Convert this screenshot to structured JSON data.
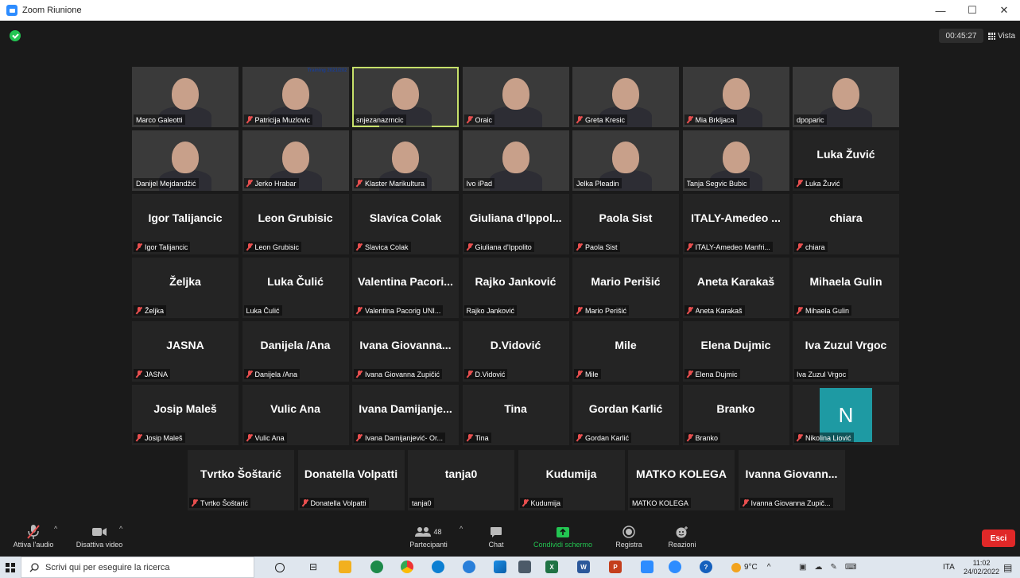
{
  "window": {
    "title": "Zoom Riunione",
    "minimize": "—",
    "maximize": "☐",
    "close": "✕"
  },
  "header": {
    "timer": "00:45:27",
    "view_label": "Vista"
  },
  "tiles": [
    {
      "id": "t1",
      "big": "",
      "label": "Marco Galeotti",
      "muted": false,
      "video": true,
      "bg": "bg1"
    },
    {
      "id": "t2",
      "big": "",
      "label": "Patricija Muzlovic",
      "muted": true,
      "video": true,
      "bg": "bg2",
      "overlay": "Training 2021/202"
    },
    {
      "id": "t3",
      "big": "",
      "label": "snjezanazrncic",
      "muted": false,
      "video": true,
      "bg": "bg3",
      "active": true
    },
    {
      "id": "t4",
      "big": "",
      "label": "Oraic",
      "muted": true,
      "video": true,
      "bg": "bg4"
    },
    {
      "id": "t5",
      "big": "",
      "label": "Greta Kresic",
      "muted": true,
      "video": true,
      "bg": "bg5"
    },
    {
      "id": "t6",
      "big": "",
      "label": "Mia Brkljaca",
      "muted": true,
      "video": true,
      "bg": "bg6"
    },
    {
      "id": "t7",
      "big": "",
      "label": "dpoparic",
      "muted": false,
      "video": true,
      "bg": "bg7"
    },
    {
      "id": "t8",
      "big": "",
      "label": "Danijel Mejdandžić",
      "muted": false,
      "video": true,
      "bg": "bg8"
    },
    {
      "id": "t9",
      "big": "",
      "label": "Jerko Hrabar",
      "muted": true,
      "video": true,
      "bg": "bg9"
    },
    {
      "id": "t10",
      "big": "",
      "label": "Klaster Marikultura",
      "muted": true,
      "video": true,
      "bg": "bg10"
    },
    {
      "id": "t11",
      "big": "",
      "label": "Ivo iPad",
      "muted": false,
      "video": true,
      "bg": "bg11"
    },
    {
      "id": "t12",
      "big": "",
      "label": "Jelka Pleadin",
      "muted": false,
      "video": true,
      "bg": "bg12"
    },
    {
      "id": "t13",
      "big": "",
      "label": "Tanja Segvic Bubic",
      "muted": false,
      "video": true,
      "bg": "bg13"
    },
    {
      "id": "t14",
      "big": "Luka Žuvić",
      "label": "Luka Žuvić",
      "muted": true,
      "video": false
    },
    {
      "id": "t15",
      "big": "Igor Talijancic",
      "label": "Igor Talijancic",
      "muted": true,
      "video": false
    },
    {
      "id": "t16",
      "big": "Leon Grubisic",
      "label": "Leon Grubisic",
      "muted": true,
      "video": false
    },
    {
      "id": "t17",
      "big": "Slavica Colak",
      "label": "Slavica Colak",
      "muted": true,
      "video": false
    },
    {
      "id": "t18",
      "big": "Giuliana d'Ippol...",
      "label": "Giuliana d'Ippolito",
      "muted": true,
      "video": false
    },
    {
      "id": "t19",
      "big": "Paola Sist",
      "label": "Paola Sist",
      "muted": true,
      "video": false
    },
    {
      "id": "t20",
      "big": "ITALY-Amedeo ...",
      "label": "ITALY-Amedeo Manfri...",
      "muted": true,
      "video": false
    },
    {
      "id": "t21",
      "big": "chiara",
      "label": "chiara",
      "muted": true,
      "video": false
    },
    {
      "id": "t22",
      "big": "Željka",
      "label": "Željka",
      "muted": true,
      "video": false
    },
    {
      "id": "t23",
      "big": "Luka Čulić",
      "label": "Luka Čulić",
      "muted": false,
      "video": false
    },
    {
      "id": "t24",
      "big": "Valentina Pacori...",
      "label": "Valentina Pacorig UNI...",
      "muted": true,
      "video": false
    },
    {
      "id": "t25",
      "big": "Rajko Janković",
      "label": "Rajko Janković",
      "muted": false,
      "video": false
    },
    {
      "id": "t26",
      "big": "Mario Perišić",
      "label": "Mario Perišić",
      "muted": true,
      "video": false
    },
    {
      "id": "t27",
      "big": "Aneta Karakaš",
      "label": "Aneta Karakaš",
      "muted": true,
      "video": false
    },
    {
      "id": "t28",
      "big": "Mihaela Gulin",
      "label": "Mihaela Gulin",
      "muted": true,
      "video": false
    },
    {
      "id": "t29",
      "big": "JASNA",
      "label": "JASNA",
      "muted": true,
      "video": false
    },
    {
      "id": "t30",
      "big": "Danijela /Ana",
      "label": "Danijela /Ana",
      "muted": true,
      "video": false
    },
    {
      "id": "t31",
      "big": "Ivana Giovanna...",
      "label": "Ivana Giovanna Zupičić",
      "muted": true,
      "video": false
    },
    {
      "id": "t32",
      "big": "D.Vidović",
      "label": "D.Vidović",
      "muted": true,
      "video": false
    },
    {
      "id": "t33",
      "big": "Mile",
      "label": "Mile",
      "muted": true,
      "video": false
    },
    {
      "id": "t34",
      "big": "Elena Dujmic",
      "label": "Elena Dujmic",
      "muted": true,
      "video": false
    },
    {
      "id": "t35",
      "big": "Iva Zuzul Vrgoc",
      "label": "Iva Zuzul Vrgoc",
      "muted": false,
      "video": false
    },
    {
      "id": "t36",
      "big": "Josip Maleš",
      "label": "Josip Maleš",
      "muted": true,
      "video": false
    },
    {
      "id": "t37",
      "big": "Vulic Ana",
      "label": "Vulic Ana",
      "muted": true,
      "video": false
    },
    {
      "id": "t38",
      "big": "Ivana Damijanje...",
      "label": "Ivana Damijanjević- Or...",
      "muted": true,
      "video": false
    },
    {
      "id": "t39",
      "big": "Tina",
      "label": "Tina",
      "muted": true,
      "video": false
    },
    {
      "id": "t40",
      "big": "Gordan Karlić",
      "label": "Gordan Karlić",
      "muted": true,
      "video": false
    },
    {
      "id": "t41",
      "big": "Branko",
      "label": "Branko",
      "muted": true,
      "video": false
    },
    {
      "id": "t42",
      "big": "",
      "label": "Nikolina Liović",
      "muted": true,
      "video": false,
      "avatar": "N"
    },
    {
      "id": "t43",
      "big": "Tvrtko Šoštarić",
      "label": "Tvrtko Šoštarić",
      "muted": true,
      "video": false
    },
    {
      "id": "t44",
      "big": "Donatella Volpatti",
      "label": "Donatella Volpatti",
      "muted": true,
      "video": false
    },
    {
      "id": "t45",
      "big": "tanja0",
      "label": "tanja0",
      "muted": false,
      "video": false
    },
    {
      "id": "t46",
      "big": "Kudumija",
      "label": "Kudumija",
      "muted": true,
      "video": false
    },
    {
      "id": "t47",
      "big": "MATKO KOLEGA",
      "label": "MATKO KOLEGA",
      "muted": false,
      "video": false
    },
    {
      "id": "t48",
      "big": "Ivanna Giovann...",
      "label": "Ivanna Giovanna Zupič...",
      "muted": true,
      "video": false
    }
  ],
  "toolbar": {
    "audio_label": "Attiva l'audio",
    "video_label": "Disattiva video",
    "participants_label": "Partecipanti",
    "participants_count": "48",
    "chat_label": "Chat",
    "share_label": "Condividi schermo",
    "record_label": "Registra",
    "reactions_label": "Reazioni",
    "exit_label": "Esci",
    "share_color": "#23c552",
    "exit_color": "#e02828"
  },
  "taskbar": {
    "search_placeholder": "Scrivi qui per eseguire la ricerca",
    "weather": "9°C",
    "lang": "ITA",
    "time": "11:02",
    "date": "24/02/2022",
    "word_label": "W",
    "excel_label": "X",
    "ppt_label": "P"
  },
  "colors": {
    "background": "#1a1a1a",
    "tile": "#242424",
    "active_speaker": "#c6e06a",
    "mute": "#e84f4f"
  }
}
